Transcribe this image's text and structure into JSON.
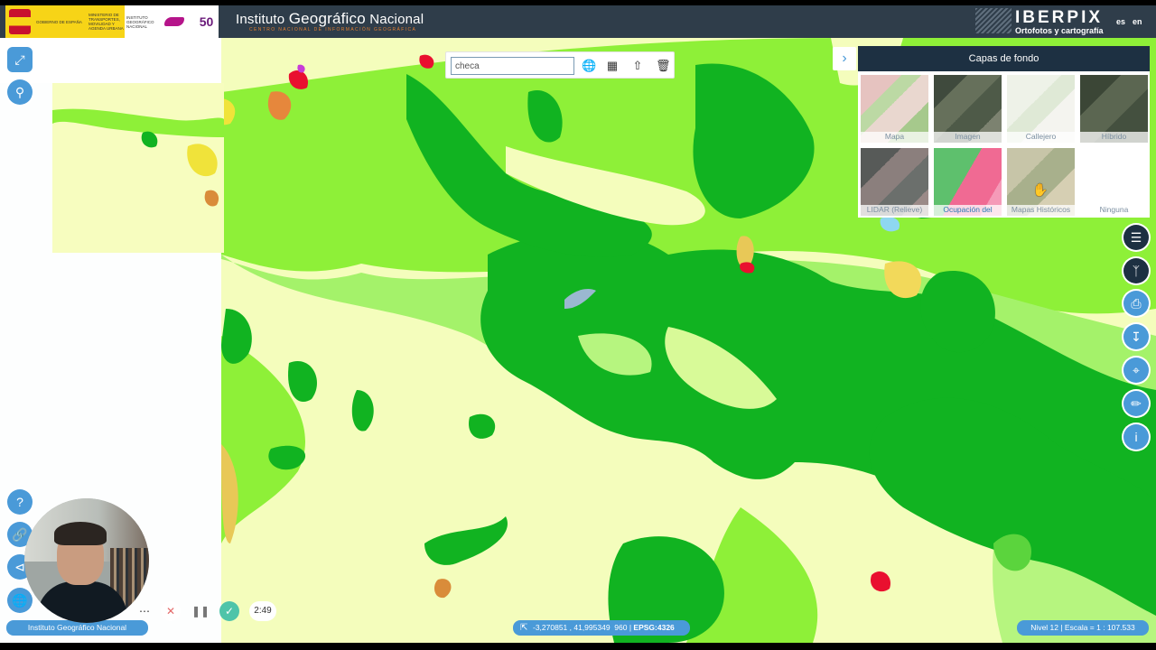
{
  "header": {
    "gov_text": "GOBIERNO DE ESPAÑA",
    "ministry_text": "MINISTERIO DE TRANSPORTES, MOVILIDAD Y AGENDA URBANA",
    "agency_text": "INSTITUTO GEOGRÁFICO NACIONAL",
    "anniversary": "50",
    "title_prefix": "Instituto",
    "title_main": "Geográfico",
    "title_suffix": "Nacional",
    "subtitle": "CENTRO NACIONAL DE INFORMACIÓN GEOGRÁFICA",
    "brand_name": "IBERPIX",
    "brand_sub": "Ortofotos y cartografía",
    "lang_es": "es",
    "lang_en": "en"
  },
  "search": {
    "value": "checa"
  },
  "toolbar_icons": [
    "globe-icon",
    "layers-grid-icon",
    "upload-icon",
    "trash-icon"
  ],
  "base_layers": {
    "title": "Capas de fondo",
    "items": [
      {
        "label": "Mapa",
        "selected": false
      },
      {
        "label": "Imagen",
        "selected": false
      },
      {
        "label": "Callejero",
        "selected": false
      },
      {
        "label": "Híbrido",
        "selected": false
      },
      {
        "label": "LIDAR (Relieve)",
        "selected": false
      },
      {
        "label": "Ocupación del",
        "selected": true
      },
      {
        "label": "Mapas Históricos",
        "selected": false
      },
      {
        "label": "Ninguna",
        "selected": false
      }
    ]
  },
  "status": {
    "coords": "-3,270851 , 41,995349",
    "zoom_value": "960",
    "crs": "EPSG:4326",
    "scale": "Nivel 12 | Escala = 1 : 107.533",
    "org_label": "Instituto Geográfico Nacional"
  },
  "recording": {
    "timer": "2:49"
  },
  "colors": {
    "header_bg": "#2f3d4a",
    "accent": "#4a9ad8",
    "panel_head": "#1d3042",
    "forest": "#11b321",
    "grass": "#8ef038",
    "crop": "#f4fdbc"
  }
}
